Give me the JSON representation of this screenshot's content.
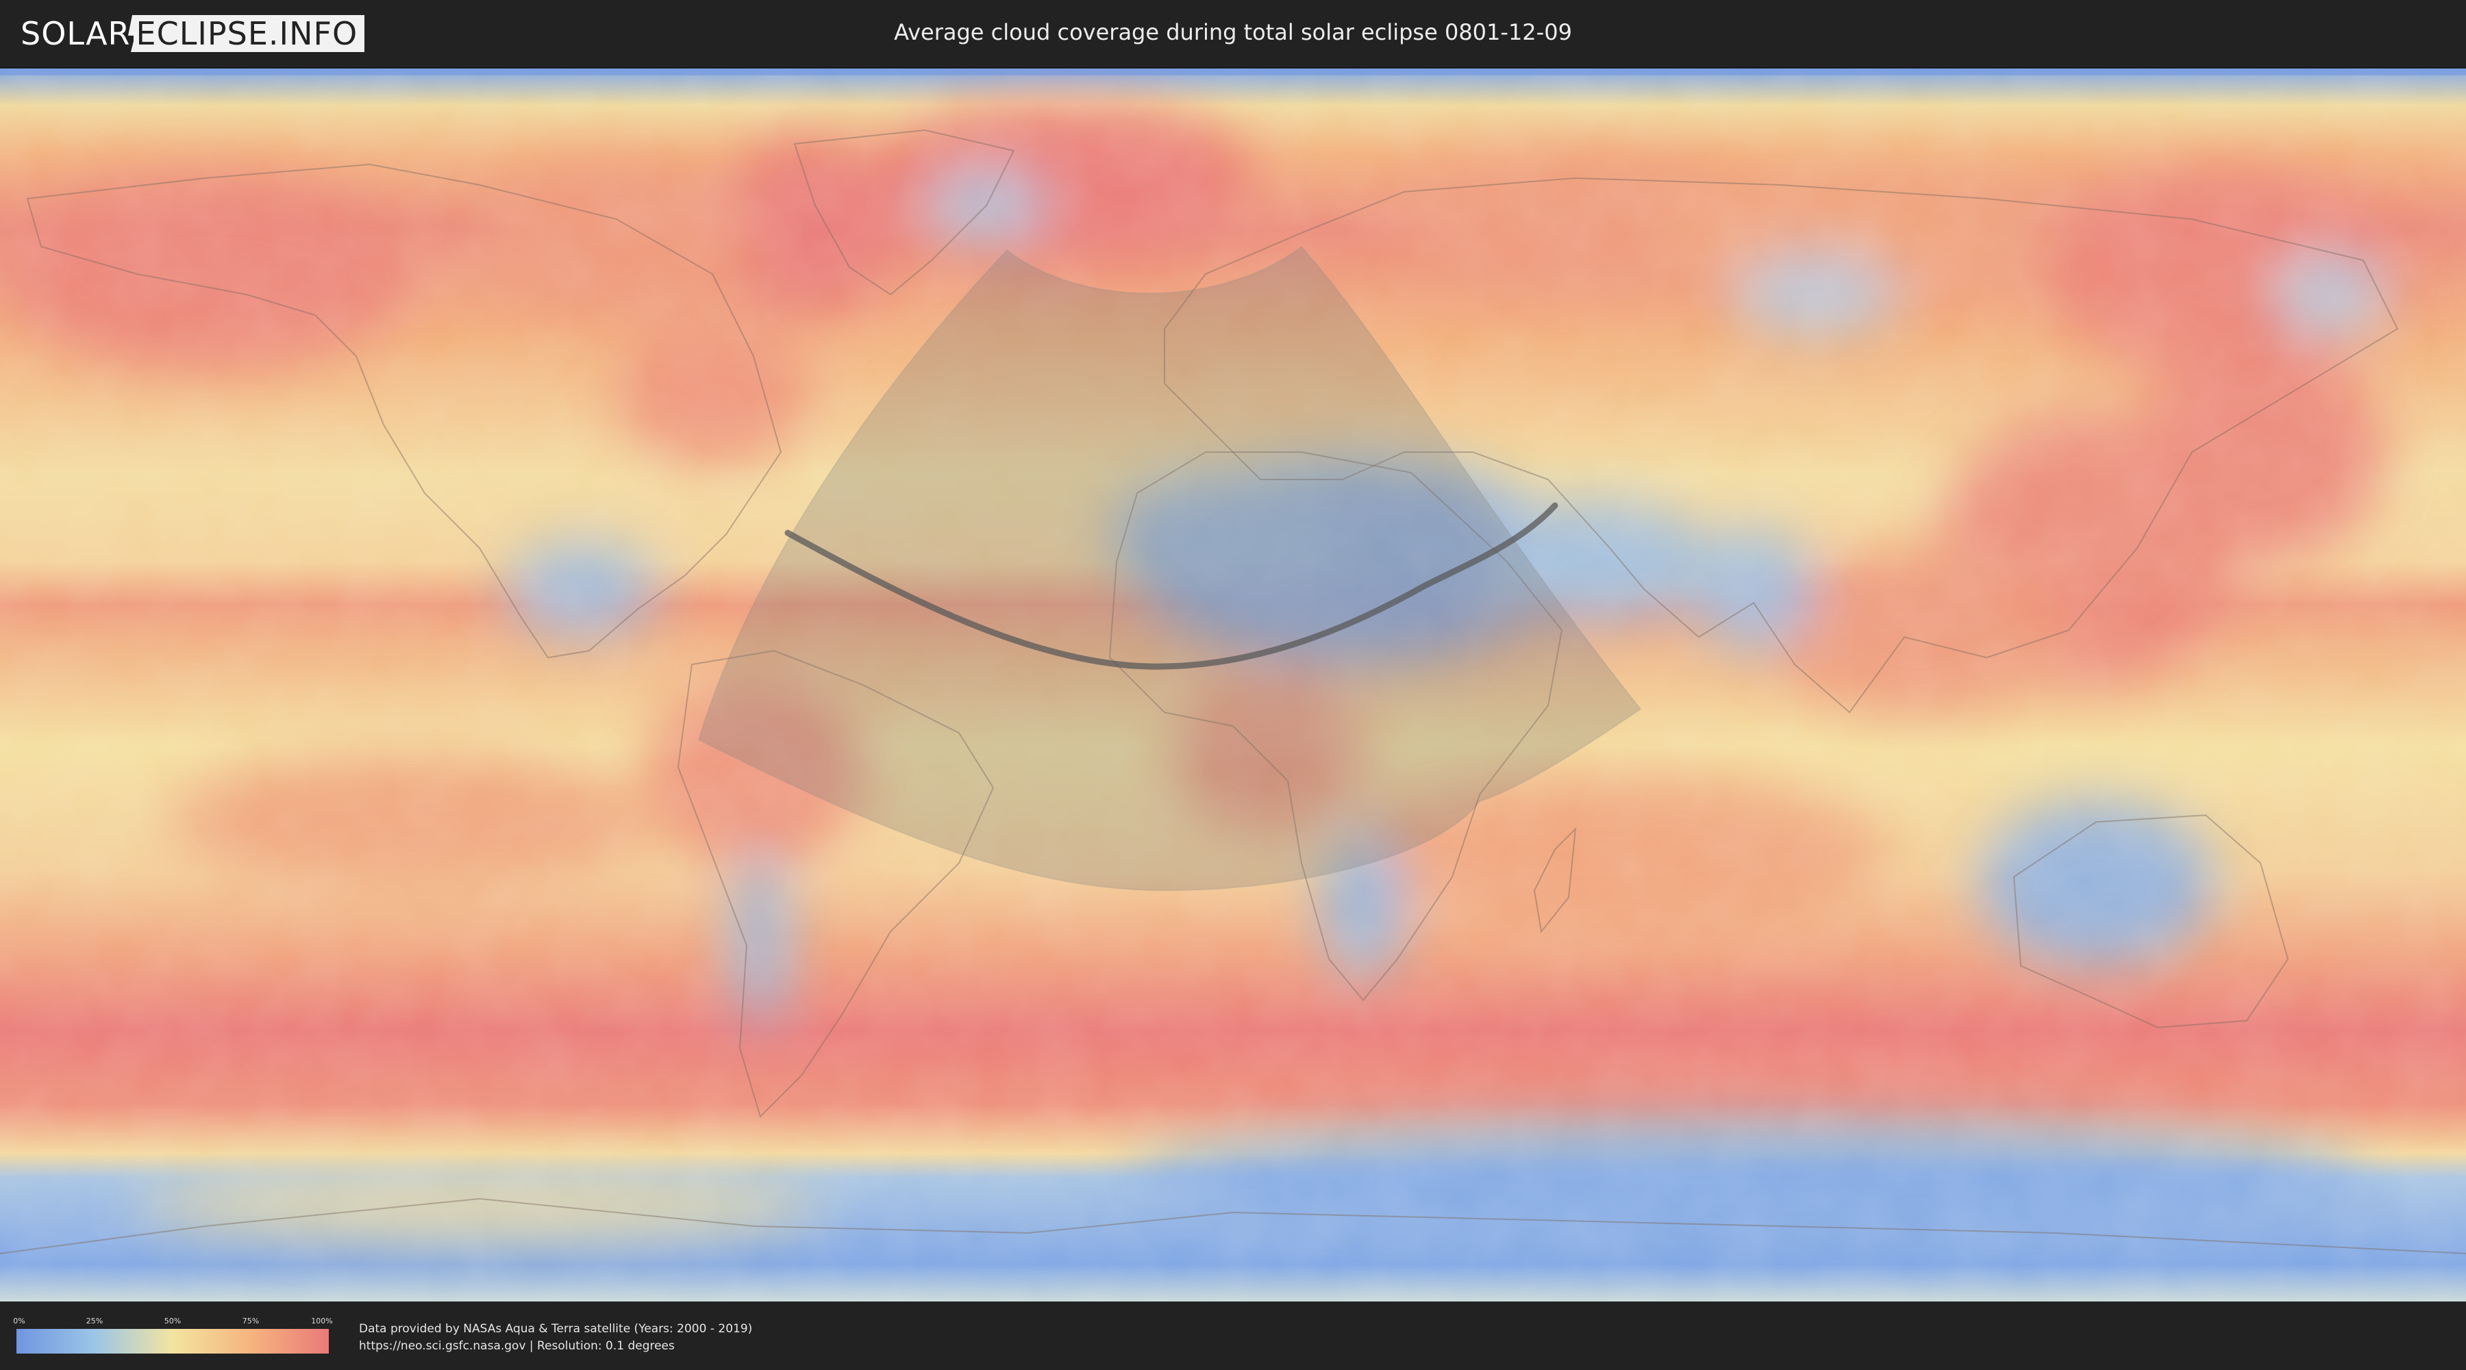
{
  "header": {
    "logo_left": "SOLAR",
    "logo_right": "ECLIPSE.INFO",
    "title": "Average cloud coverage during total solar eclipse 0801-12-09"
  },
  "legend": {
    "ticks": [
      "0%",
      "25%",
      "50%",
      "75%",
      "100%"
    ],
    "gradient_colors": [
      "#6f96e0",
      "#9cc5e6",
      "#f3e4a0",
      "#f5b47f",
      "#ea7a78"
    ]
  },
  "footer": {
    "credit_line1": "Data provided by NASAs Aqua & Terra satellite (Years: 2000 - 2019)",
    "credit_line2": "https://neo.sci.gsfc.nasa.gov | Resolution: 0.1 degrees"
  },
  "map": {
    "projection": "equirectangular",
    "colors": {
      "low_cloud": "#7fa6e4",
      "mid_cloud": "#f3e1a0",
      "high_cloud": "#eb7f78",
      "eclipse_visibility_zone": "#7a7a7a",
      "central_line": "#5a5a5a"
    }
  }
}
